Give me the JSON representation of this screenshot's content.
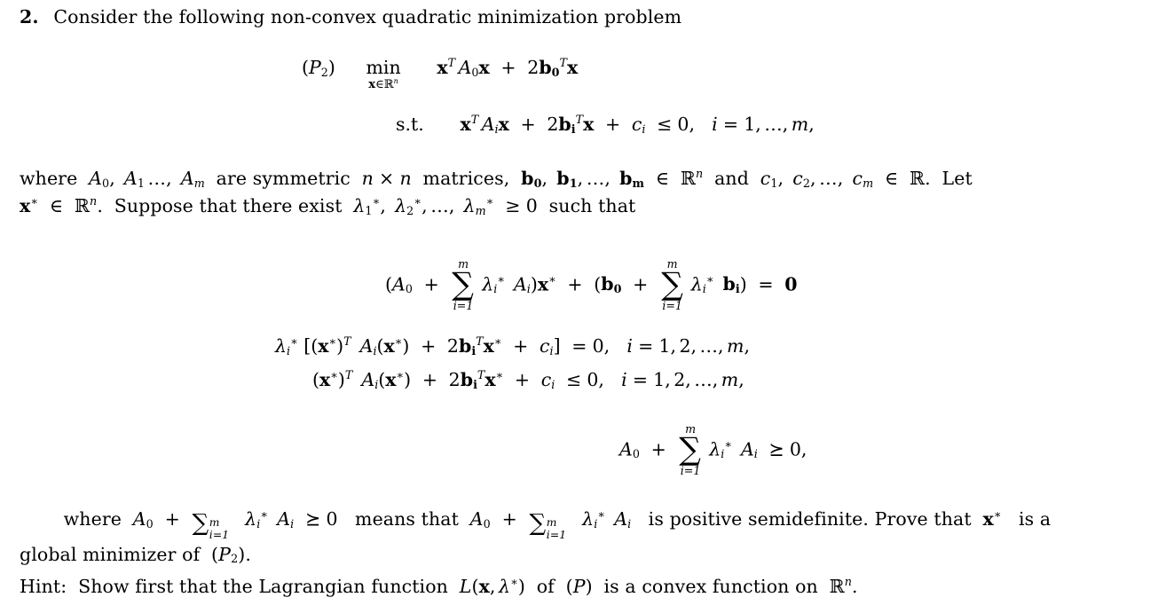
{
  "document": {
    "type": "math-exercise",
    "background_color": "#ffffff",
    "text_color": "#000000",
    "problem_number": "2.",
    "intro_text": "Consider the following non-convex quadratic minimization problem",
    "problem_label": "(P2)",
    "problem_label_base": "P",
    "problem_label_sub": "2",
    "objective": {
      "operator": "min",
      "operator_subscript": "x∈ℝⁿ",
      "expression": "xᵀA₀x + 2b₀ᵀx"
    },
    "constraint": {
      "label": "s.t.",
      "expression": "xᵀAᵢx + 2bᵢᵀx + cᵢ ≤ 0,  i = 1, … , m,"
    },
    "where_paragraph": {
      "line1": "where A₀, A₁ … , A_m are symmetric n × n matrices, b₀, b₁, … , b_m ∈ ℝⁿ and c₁, c₂, … , c_m ∈ ℝ.  Let",
      "line2": "x* ∈ ℝⁿ. Suppose that there exist λ₁*, λ₂*, … , λ_m* ≥ 0 such that"
    },
    "kkt_conditions": [
      {
        "name": "stationarity",
        "latex": "(A_0 + \\sum_{i=1}^m \\lambda_i^* A_i)x^* + (b_0 + \\sum_{i=1}^m \\lambda_i^* b_i) = 0"
      },
      {
        "name": "complementary-slackness",
        "latex": "\\lambda_i^*[(x^*)^T A_i(x^*) + 2b_i^T x^* + c_i] = 0,\\; i = 1,2,\\ldots,m,"
      },
      {
        "name": "primal-feasibility",
        "latex": "(x^*)^T A_i(x^*) + 2b_i^T x^* + c_i \\le 0,\\; i = 1,2,\\ldots,m,"
      },
      {
        "name": "second-order-psd",
        "latex": "A_0 + \\sum_{i=1}^m \\lambda_i^* A_i \\succeq 0,"
      }
    ],
    "closing_paragraph": {
      "line1_a": "where",
      "line1_b": "means that",
      "line1_c": "is positive semidefinite.  Prove that",
      "line1_d": "is a",
      "line2_a": "global minimizer of",
      "line2_b": "."
    },
    "hint": {
      "label": "Hint:",
      "text_a": "Show first that the Lagrangian function",
      "lagrangian": "L(x, λ*)",
      "text_b": "of",
      "problem_ref": "(P)",
      "text_c": "is a convex function on",
      "domain": "ℝⁿ",
      "period": "."
    },
    "symbols": {
      "sum": "∑",
      "in": "∈",
      "leq": "≤",
      "geq": "≥",
      "succeq": "⪰",
      "times": "×",
      "ldots": "…",
      "reals": "ℝ",
      "lambda": "λ",
      "star": "∗",
      "equals": "=",
      "plus": "+",
      "zero_bold": "0"
    }
  }
}
